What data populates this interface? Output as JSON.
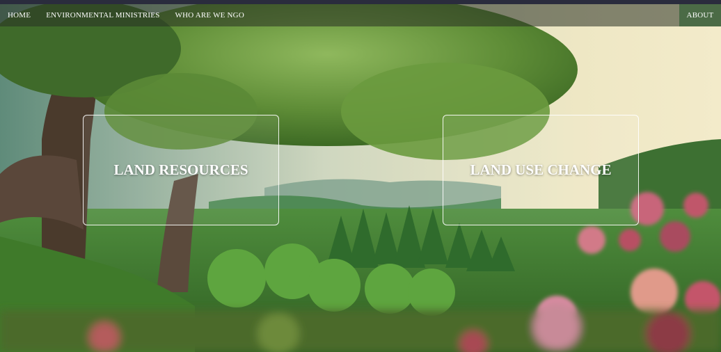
{
  "nav": {
    "items": [
      {
        "label": "HOME"
      },
      {
        "label": "ENVIRONMENTAL MINISTRIES"
      },
      {
        "label": "WHO ARE WE NGO"
      }
    ],
    "about_label": "ABOUT"
  },
  "cards": [
    {
      "title": "LAND RESOURCES"
    },
    {
      "title": "LAND USE CHANGE"
    }
  ],
  "colors": {
    "nav_background": "#283022",
    "about_background": "#4b6b46",
    "card_border": "#ffffff",
    "text": "#ffffff"
  }
}
